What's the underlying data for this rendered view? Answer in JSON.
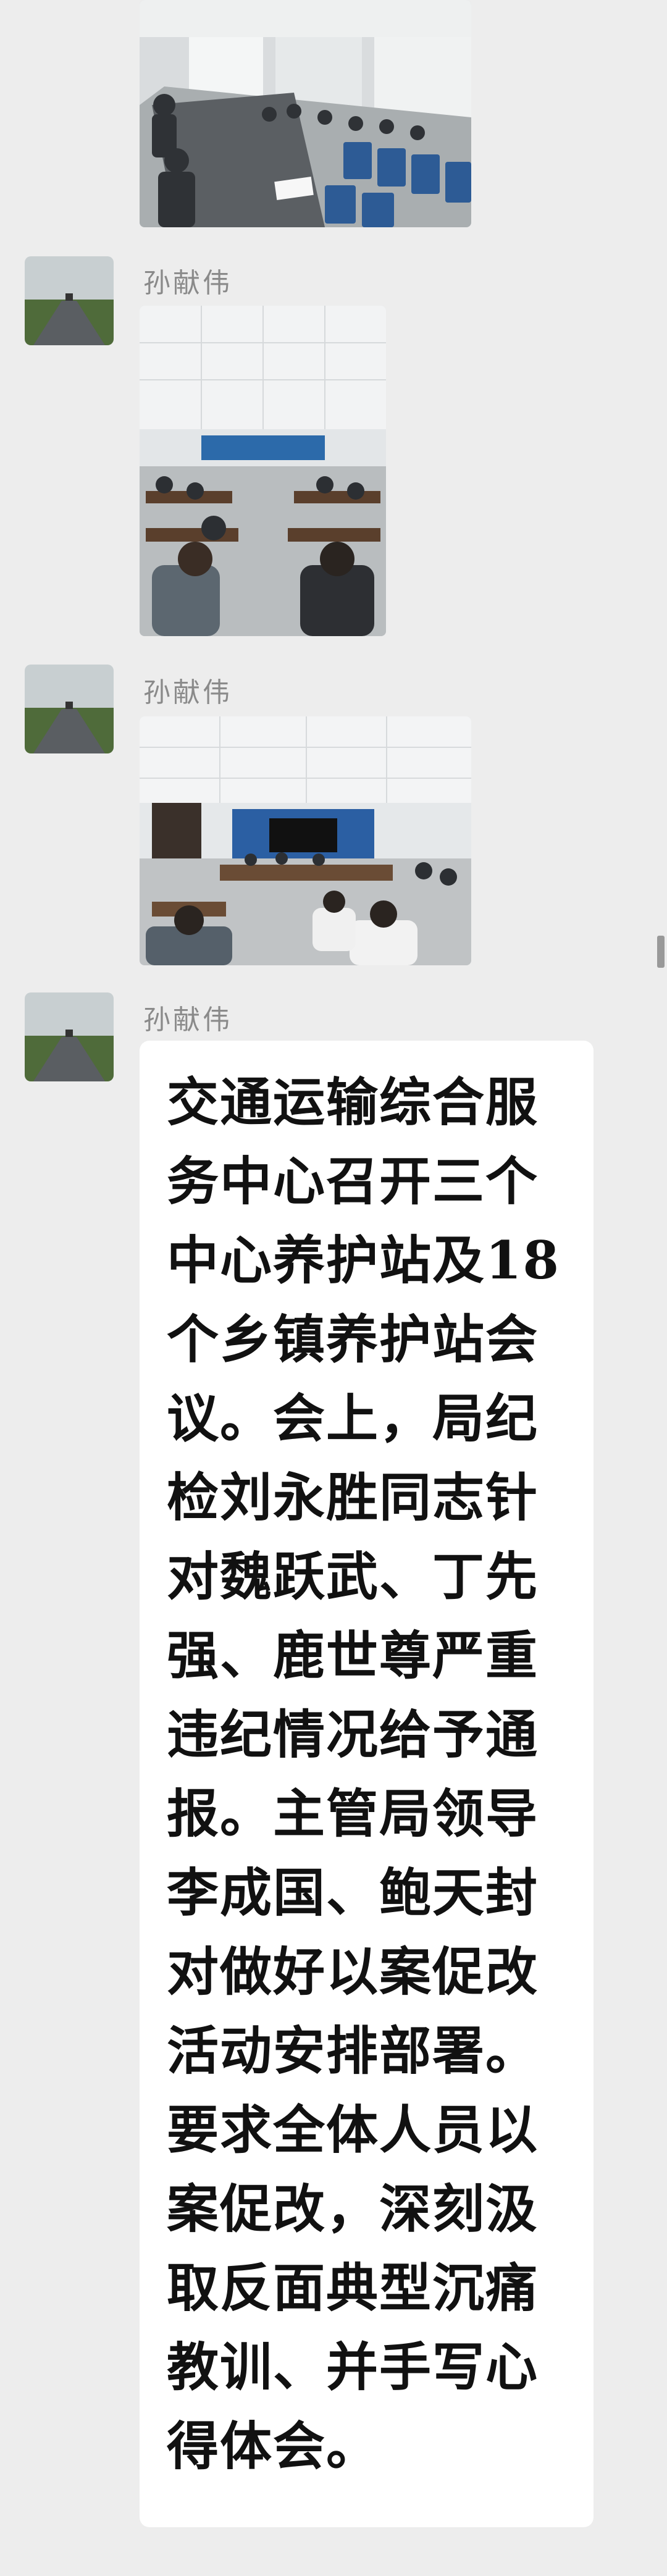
{
  "messages": [
    {
      "type": "image",
      "description_icon": "meeting-room-photo"
    },
    {
      "type": "image",
      "sender": "孙献伟",
      "description_icon": "meeting-room-photo"
    },
    {
      "type": "image",
      "sender": "孙献伟",
      "description_icon": "meeting-room-photo"
    },
    {
      "type": "text",
      "sender": "孙献伟",
      "text": "交通运输综合服务中心召开三个中心养护站及18个乡镇养护站会议。会上，局纪检刘永胜同志针对魏跃武、丁先强、鹿世尊严重违纪情况给予通报。主管局领导李成国、鲍天封对做好以案促改活动安排部署。要求全体人员以案促改，深刻汲取反面典型沉痛教训、并手写心得体会。"
    }
  ],
  "colors": {
    "background": "#ededed",
    "bubble": "#ffffff",
    "sender_name": "#8a8a8a",
    "text": "#111111"
  }
}
